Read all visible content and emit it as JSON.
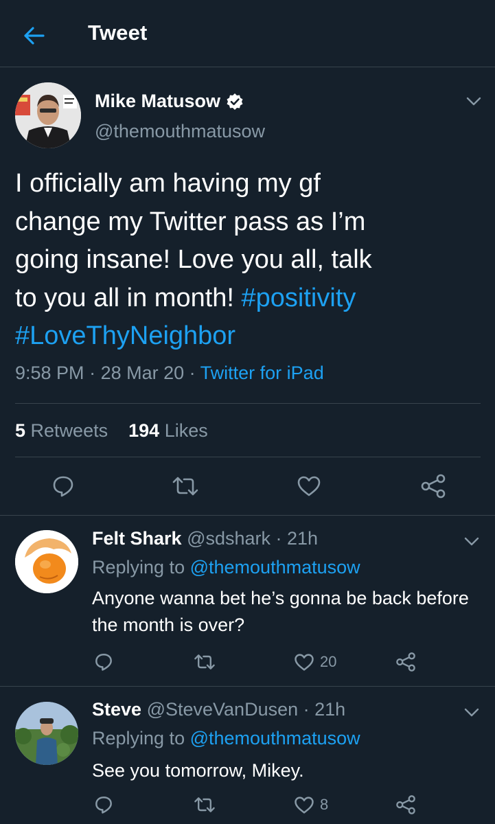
{
  "header": {
    "title": "Tweet",
    "back_icon": "arrow-left-icon"
  },
  "colors": {
    "background": "#15202b",
    "accent": "#1da1f2",
    "muted": "#8899a6",
    "divider": "#38444d"
  },
  "tweet": {
    "author_name": "Mike Matusow",
    "author_handle": "@themouthmatusow",
    "verified": true,
    "text_lines": [
      "I officially am having my gf",
      "change my Twitter pass as I’m",
      "going insane! Love you all, talk",
      "to you all in month!"
    ],
    "hashtag_1": "#positivity",
    "hashtag_2": "#LoveThyNeighbor",
    "time": "9:58 PM",
    "date": "28 Mar 20",
    "source": "Twitter for iPad",
    "separator": " · ",
    "retweets_count": "5",
    "retweets_label": "Retweets",
    "likes_count": "194",
    "likes_label": "Likes"
  },
  "replies": [
    {
      "name": "Felt Shark",
      "handle": "@sdshark",
      "time": "21h",
      "replying_label": "Replying to",
      "mention": "@themouthmatusow",
      "text": "Anyone wanna bet he’s gonna be back before the month is over?",
      "likes": "20"
    },
    {
      "name": "Steve",
      "handle": "@SteveVanDusen",
      "time": "21h",
      "replying_label": "Replying to",
      "mention": "@themouthmatusow",
      "text": "See you tomorrow, Mikey.",
      "likes": "8"
    }
  ]
}
